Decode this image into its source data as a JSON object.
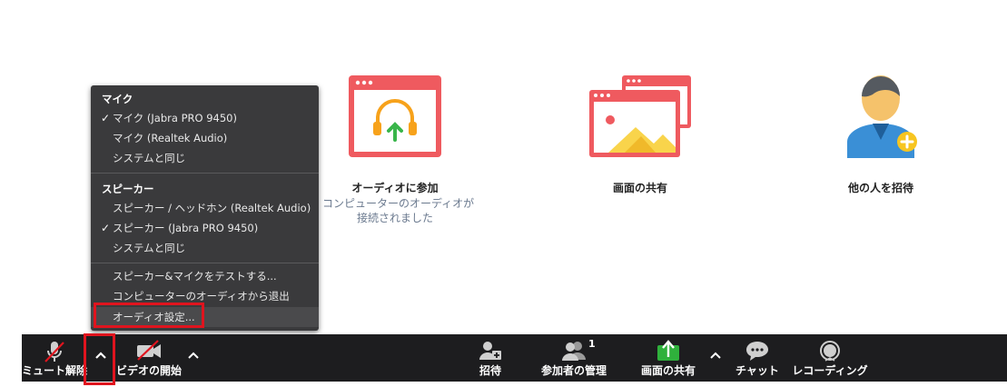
{
  "menu": {
    "mic_header": "マイク",
    "mic_items": [
      {
        "label": "マイク (Jabra PRO 9450)",
        "checked": true
      },
      {
        "label": "マイク (Realtek Audio)",
        "checked": false
      },
      {
        "label": "システムと同じ",
        "checked": false
      }
    ],
    "speaker_header": "スピーカー",
    "speaker_items": [
      {
        "label": "スピーカー / ヘッドホン (Realtek Audio)",
        "checked": false
      },
      {
        "label": "スピーカー (Jabra PRO 9450)",
        "checked": true
      },
      {
        "label": "システムと同じ",
        "checked": false
      }
    ],
    "actions": [
      {
        "label": "スピーカー&マイクをテストする..."
      },
      {
        "label": "コンピューターのオーディオから退出"
      },
      {
        "label": "オーディオ設定..."
      }
    ],
    "check_glyph": "✓"
  },
  "tiles": {
    "audio": {
      "label": "オーディオに参加",
      "sub1": "コンピューターのオーディオが",
      "sub2": "接続されました"
    },
    "share": {
      "label": "画面の共有"
    },
    "invite": {
      "label": "他の人を招待"
    }
  },
  "toolbar": {
    "unmute": "ミュート解除",
    "start_video": "ビデオの開始",
    "invite": "招待",
    "participants": "参加者の管理",
    "participants_count": "1",
    "share": "画面の共有",
    "chat": "チャット",
    "record": "レコーディング",
    "caret": "^"
  },
  "colors": {
    "tile_red": "#ef5a5f",
    "headphone_orange": "#f7a21b",
    "arrow_green": "#39b54a",
    "share_green": "#2fb13c",
    "toolbar_bg": "#1d1d1f",
    "highlight_red": "#e0141e"
  }
}
